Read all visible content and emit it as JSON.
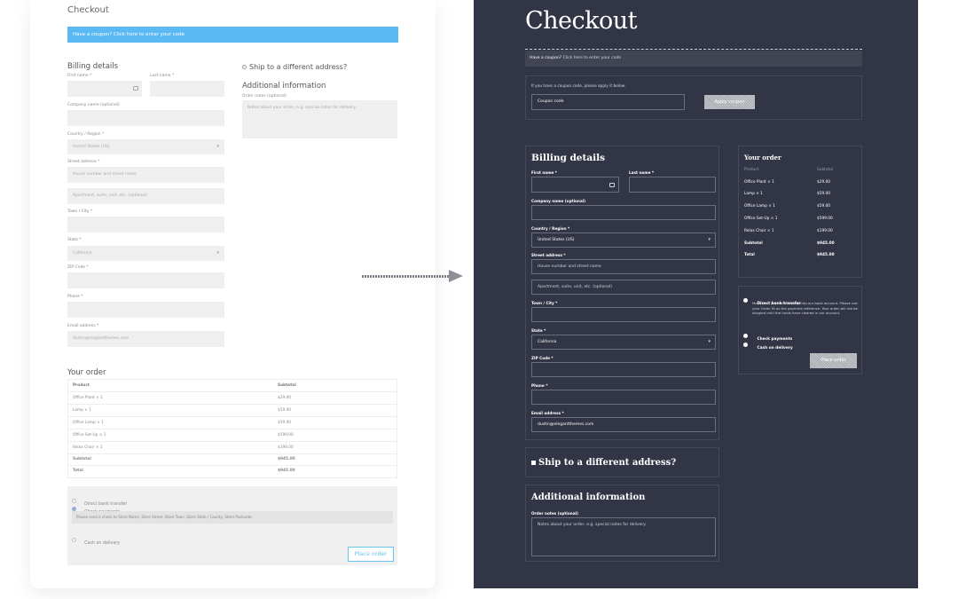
{
  "left": {
    "title": "Checkout",
    "coupon_notice": "Have a coupon? Click here to enter your code",
    "billing_title": "Billing details",
    "first_name_label": "First name *",
    "last_name_label": "Last name *",
    "company_label": "Company name (optional)",
    "country_label": "Country / Region *",
    "country_value": "United States (US)",
    "street_label": "Street address *",
    "street_placeholder": "House number and street name",
    "apartment_placeholder": "Apartment, suite, unit, etc. (optional)",
    "town_label": "Town / City *",
    "state_label": "State *",
    "state_value": "California",
    "zip_label": "ZIP Code *",
    "phone_label": "Phone *",
    "email_label": "Email address *",
    "email_value": "dustin@elegantthemes.com",
    "ship_label": "Ship to a different address?",
    "additional_title": "Additional information",
    "order_notes_label": "Order notes (optional)",
    "order_notes_placeholder": "Notes about your order, e.g. special notes for delivery.",
    "your_order_title": "Your order",
    "col_product": "Product",
    "col_subtotal": "Subtotal",
    "rows": [
      {
        "product": "Office Plant × 1",
        "subtotal": "$29.00"
      },
      {
        "product": "Lamp × 1",
        "subtotal": "$59.00"
      },
      {
        "product": "Office Lamp × 1",
        "subtotal": "$59.00"
      },
      {
        "product": "Office Set-Up × 1",
        "subtotal": "$599.00"
      },
      {
        "product": "Relax Chair × 1",
        "subtotal": "$199.00"
      },
      {
        "product": "Subtotal",
        "subtotal": "$945.00"
      },
      {
        "product": "Total",
        "subtotal": "$945.00"
      }
    ],
    "pay_bank": "Direct bank transfer",
    "pay_check": "Check payments",
    "pay_check_info": "Please send a check to Store Name, Store Street, Store Town, Store State / County, Store Postcode.",
    "pay_cod": "Cash on delivery",
    "place_order": "Place order"
  },
  "right": {
    "title": "Checkout",
    "coupon_q": "Have a coupon?",
    "coupon_link": "Click here to enter your code",
    "coupon_help": "If you have a coupon code, please apply it below.",
    "coupon_placeholder": "Coupon code",
    "apply_button": "Apply coupon",
    "billing_title": "Billing details",
    "first_name_label": "First name *",
    "last_name_label": "Last name *",
    "company_label": "Company name (optional)",
    "country_label": "Country / Region *",
    "country_value": "United States (US)",
    "street_label": "Street address *",
    "street_placeholder": "House number and street name",
    "apartment_placeholder": "Apartment, suite, unit, etc. (optional)",
    "town_label": "Town / City *",
    "state_label": "State *",
    "state_value": "California",
    "zip_label": "ZIP Code *",
    "phone_label": "Phone *",
    "email_label": "Email address *",
    "email_value": "dustin@elegantthemes.com",
    "ship_label": "Ship to a different address?",
    "additional_title": "Additional information",
    "order_notes_label": "Order notes (optional)",
    "order_notes_placeholder": "Notes about your order, e.g. special notes for delivery.",
    "your_order_title": "Your order",
    "col_product": "Product",
    "col_subtotal": "Subtotal",
    "rows": [
      {
        "product": "Office Plant × 1",
        "subtotal": "$29.00"
      },
      {
        "product": "Lamp × 1",
        "subtotal": "$59.00"
      },
      {
        "product": "Office Lamp × 1",
        "subtotal": "$59.00"
      },
      {
        "product": "Office Set-Up × 1",
        "subtotal": "$599.00"
      },
      {
        "product": "Relax Chair × 1",
        "subtotal": "$199.00"
      },
      {
        "product": "Subtotal",
        "subtotal": "$945.00"
      },
      {
        "product": "Total",
        "subtotal": "$945.00"
      }
    ],
    "pay_bank": "Direct bank transfer",
    "pay_bank_desc": "Make your payment directly into our bank account. Please use your Order ID as the payment reference. Your order will not be shipped until the funds have cleared in our account.",
    "pay_check": "Check payments",
    "pay_cod": "Cash on delivery",
    "place_order": "Place order"
  },
  "colors": {
    "dark_bg": "#323545",
    "coupon_blue": "#5ab8f2",
    "place_order_outline": "#66c4f0"
  },
  "icons": [
    "contact-card-icon",
    "chevron-down-icon",
    "arrow-right-icon"
  ]
}
